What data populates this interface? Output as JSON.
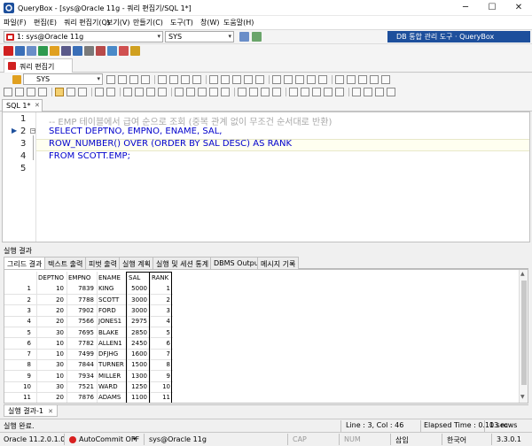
{
  "window": {
    "title": "QueryBox - [sys@Oracle 11g - 쿼리 편집기/SQL 1*]",
    "minimize": "─",
    "maximize": "☐",
    "close": "✕"
  },
  "menu": [
    "파일(F)",
    "편집(E)",
    "쿼리 편집기(Q)",
    "보기(V)",
    "만들기(C)",
    "도구(T)",
    "창(W)",
    "도움말(H)"
  ],
  "connection": {
    "selected": "1: sys@Oracle 11g",
    "schema": "SYS",
    "brand": "DB 통합 관리 도구 · QueryBox"
  },
  "doc_tab": "쿼리 편집기",
  "editor_schema": "SYS",
  "sql_tab": "SQL 1*",
  "sql_tab_close": "✕",
  "editor": {
    "lines": [
      {
        "num": "1",
        "comment": "-- EMP 테이블에서 급여 순으로 조회 (중복 관계 없이 무조건 순서대로 반환)"
      },
      {
        "num": "2",
        "text": "SELECT DEPTNO, EMPNO, ENAME, SAL,"
      },
      {
        "num": "3",
        "text": "ROW_NUMBER() OVER (ORDER BY SAL DESC) AS RANK"
      },
      {
        "num": "4",
        "text": "FROM SCOTT.EMP;"
      },
      {
        "num": "5",
        "text": ""
      }
    ]
  },
  "results": {
    "header": "실행 결과",
    "tabs": [
      "그리드 결과",
      "텍스트 출력",
      "피벗 출력",
      "실행 계획",
      "실행 및 세션 통계",
      "DBMS Output",
      "메시지 기록"
    ],
    "columns": [
      "DEPTNO",
      "EMPNO",
      "ENAME",
      "SAL",
      "RANK"
    ],
    "rows": [
      [
        "1",
        "10",
        "7839",
        "KING",
        "5000",
        "1"
      ],
      [
        "2",
        "20",
        "7788",
        "SCOTT",
        "3000",
        "2"
      ],
      [
        "3",
        "20",
        "7902",
        "FORD",
        "3000",
        "3"
      ],
      [
        "4",
        "20",
        "7566",
        "JONES1",
        "2975",
        "4"
      ],
      [
        "5",
        "30",
        "7695",
        "BLAKE",
        "2850",
        "5"
      ],
      [
        "6",
        "10",
        "7782",
        "ALLEN1",
        "2450",
        "6"
      ],
      [
        "7",
        "10",
        "7499",
        "DFJHG",
        "1600",
        "7"
      ],
      [
        "8",
        "30",
        "7844",
        "TURNER",
        "1500",
        "8"
      ],
      [
        "9",
        "10",
        "7934",
        "MILLER",
        "1300",
        "9"
      ],
      [
        "10",
        "30",
        "7521",
        "WARD",
        "1250",
        "10"
      ],
      [
        "11",
        "20",
        "7876",
        "ADAMS",
        "1100",
        "11"
      ]
    ],
    "bottom_tab": "실행 결과-1",
    "bottom_tab_close": "✕"
  },
  "status": {
    "message": "실행 완료.",
    "position": "Line : 3, Col : 46",
    "elapsed": "Elapsed Time : 0.10 sec",
    "rows": "13 rows",
    "version": "Oracle 11.2.0.1.0",
    "autocommit": "AutoCommit OFF",
    "connection": "sys@Oracle 11g",
    "cap": "CAP",
    "num": "NUM",
    "insert": "삽입",
    "lang": "한국어",
    "app_version": "3.3.0.1"
  },
  "colors": {
    "brand": "#1d4f9c",
    "keyword": "#0000cc",
    "comment": "#a8a8a8",
    "accent_red": "#d02020"
  }
}
